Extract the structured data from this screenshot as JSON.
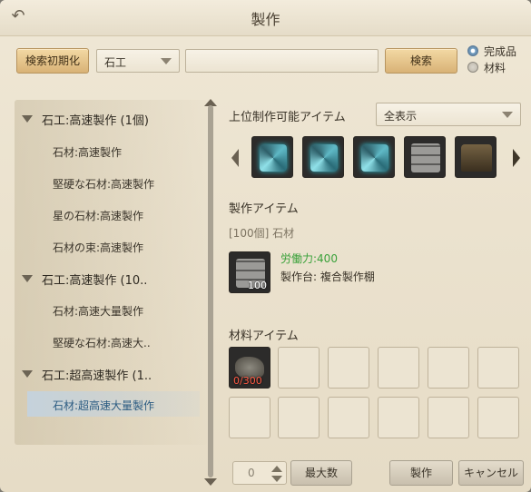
{
  "window": {
    "title": "製作"
  },
  "search": {
    "reset_label": "検索初期化",
    "category": "石工",
    "query_value": "",
    "search_label": "検索",
    "radio_options": [
      {
        "label": "完成品",
        "selected": true
      },
      {
        "label": "材料",
        "selected": false
      }
    ]
  },
  "tree": {
    "groups": [
      {
        "label": "石工:高速製作 (1個)",
        "items": [
          "石材:高速製作",
          "堅硬な石材:高速製作",
          "星の石材:高速製作",
          "石材の束:高速製作"
        ]
      },
      {
        "label": "石工:高速製作 (10..",
        "items": [
          "石材:高速大量製作",
          "堅硬な石材:高速大.."
        ]
      },
      {
        "label": "石工:超高速製作 (1..",
        "items": [
          "石材:超高速大量製作"
        ]
      }
    ],
    "selected_item": "石材:超高速大量製作"
  },
  "upper": {
    "label": "上位制作可能アイテム",
    "filter": "全表示",
    "icons": [
      "crystal-cube-icon",
      "crystal-cube-icon",
      "crystal-cube-icon",
      "stone-block-icon",
      "stone-stack-icon"
    ]
  },
  "craft": {
    "label": "製作アイテム",
    "item_name": "[100個] 石材",
    "item_icon": "stone-block-icon",
    "item_count": "100",
    "labor": "労働力:400",
    "station": "製作台: 複合製作棚"
  },
  "materials": {
    "label": "材料アイテム",
    "first_icon": "rock-icon",
    "first_count": "0/300"
  },
  "footer": {
    "quantity": "0",
    "max_label": "最大数",
    "craft_label": "製作",
    "cancel_label": "キャンセル"
  },
  "colors": {
    "labor_text": "#3aa13a",
    "selected_item_text": "#2c5c82",
    "insufficient_count": "#ff5a45"
  }
}
